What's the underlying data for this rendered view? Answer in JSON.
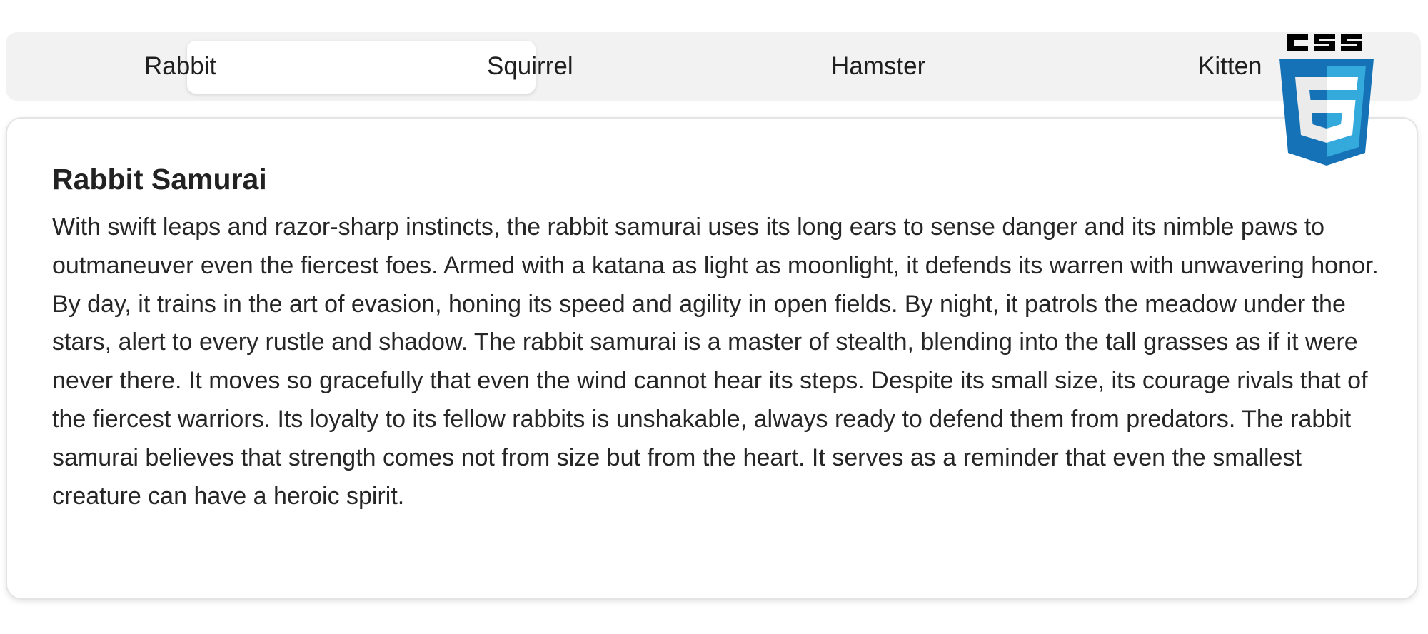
{
  "tabs": [
    {
      "label": "Rabbit",
      "selected": true
    },
    {
      "label": "Squirrel",
      "selected": false
    },
    {
      "label": "Hamster",
      "selected": false
    },
    {
      "label": "Kitten",
      "selected": false
    }
  ],
  "panel": {
    "title": "Rabbit Samurai",
    "body": "With swift leaps and razor-sharp instincts, the rabbit samurai uses its long ears to sense danger and its nimble paws to outmaneuver even the fiercest foes. Armed with a katana as light as moonlight, it defends its warren with unwavering honor. By day, it trains in the art of evasion, honing its speed and agility in open fields. By night, it patrols the meadow under the stars, alert to every rustle and shadow. The rabbit samurai is a master of stealth, blending into the tall grasses as if it were never there. It moves so gracefully that even the wind cannot hear its steps. Despite its small size, its courage rivals that of the fiercest warriors. Its loyalty to its fellow rabbits is unshakable, always ready to defend them from predators. The rabbit samurai believes that strength comes not from size but from the heart. It serves as a reminder that even the smallest creature can have a heroic spirit."
  },
  "logo": {
    "text": "CSS",
    "icon": "css3-logo-icon",
    "colors": {
      "dark_blue": "#1572b6",
      "light_blue": "#33a9dc",
      "white": "#ffffff",
      "grey": "#ebebeb",
      "black": "#000000"
    }
  }
}
